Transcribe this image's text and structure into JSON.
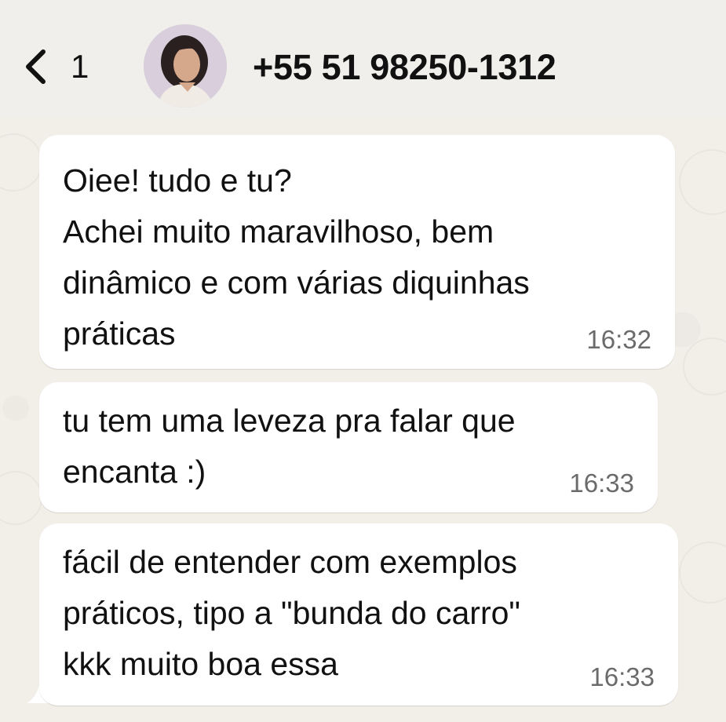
{
  "header": {
    "back_count": "1",
    "contact_name": "+55 51 98250-1312",
    "avatar_icon": "contact-avatar-photo",
    "back_icon": "chevron-left-icon"
  },
  "messages": [
    {
      "text": "Oiee! tudo e tu?\nAchei muito maravilhoso, bem\ndinâmico e com várias diquinhas\npráticas",
      "time": "16:32"
    },
    {
      "text": "tu tem uma leveza pra falar que\nencanta :)",
      "time": "16:33"
    },
    {
      "text": "fácil de entender com exemplos\npráticos, tipo a \"bunda do carro\"\nkkk muito boa essa",
      "time": "16:33"
    }
  ],
  "colors": {
    "background": "#efeae2",
    "bubble": "#ffffff",
    "timestamp": "#6b6b6b"
  }
}
